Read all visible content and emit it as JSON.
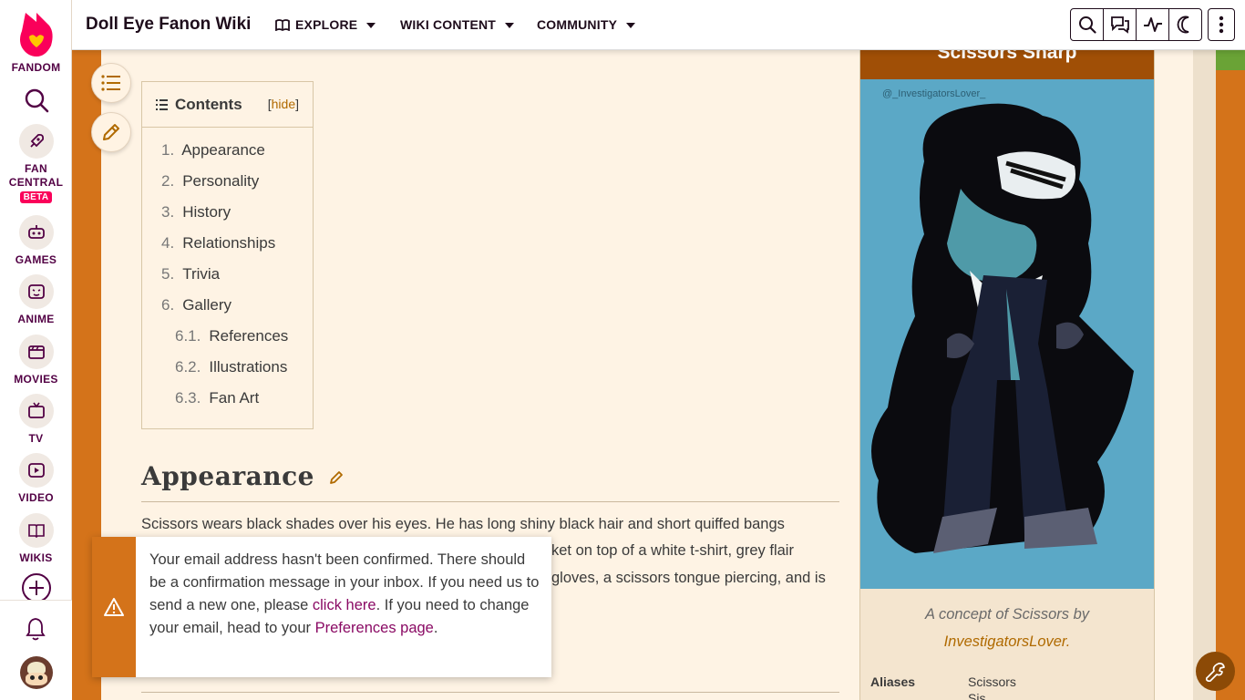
{
  "rail": {
    "fandom": "FANDOM",
    "fan_central": "FAN CENTRAL",
    "beta": "BETA",
    "games": "GAMES",
    "anime": "ANIME",
    "movies": "MOVIES",
    "tv": "TV",
    "video": "VIDEO",
    "wikis": "WIKIS"
  },
  "topnav": {
    "wiki_title": "Doll Eye Fanon Wiki",
    "explore": "EXPLORE",
    "wiki_content": "WIKI CONTENT",
    "community": "COMMUNITY"
  },
  "toc": {
    "title": "Contents",
    "hide_open": "[",
    "hide": "hide",
    "hide_close": "]",
    "items": [
      {
        "num": "1.",
        "label": "Appearance"
      },
      {
        "num": "2.",
        "label": "Personality"
      },
      {
        "num": "3.",
        "label": "History"
      },
      {
        "num": "4.",
        "label": "Relationships"
      },
      {
        "num": "5.",
        "label": "Trivia"
      },
      {
        "num": "6.",
        "label": "Gallery"
      },
      {
        "num": "6.1.",
        "label": "References"
      },
      {
        "num": "6.2.",
        "label": "Illustrations"
      },
      {
        "num": "6.3.",
        "label": "Fan Art"
      }
    ]
  },
  "content": {
    "heading": "Appearance",
    "line1": "Scissors wears black shades over his eyes. He has long shiny black hair and short quiffed bangs",
    "line2_tail": "ket on top of a white t-shirt, grey flair",
    "line3_tail": "gloves, a scissors tongue piercing, and is"
  },
  "infobox": {
    "title": "Scissors Sharp",
    "watermark": "@_InvestigatorsLover_",
    "caption_pre": "A concept of Scissors by",
    "caption_link": "InvestigatorsLover.",
    "aliases_label": "Aliases",
    "aliases_value": "Scissors",
    "aliases_value2": "Sis"
  },
  "notification": {
    "text_before": "Your email address hasn't been confirmed. There should be a confirmation message in your inbox. If you need us to send a new one, please ",
    "link1": "click here",
    "text_middle": ". If you need to change your email, head to your ",
    "link2": "Preferences page",
    "text_after": "."
  },
  "colors": {
    "accent": "#d4731a",
    "fandom_pink": "#fa005a",
    "link": "#8a0a64"
  }
}
